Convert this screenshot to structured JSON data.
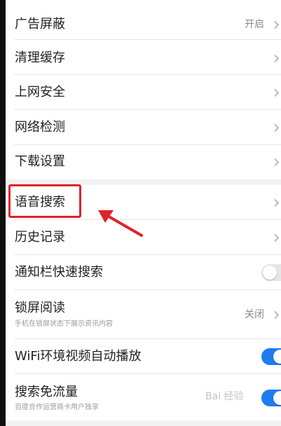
{
  "settings": {
    "ad_block": {
      "label": "广告屏蔽",
      "value": "开启"
    },
    "clear_cache": {
      "label": "清理缓存"
    },
    "web_security": {
      "label": "上网安全"
    },
    "network_check": {
      "label": "网络检测"
    },
    "download_settings": {
      "label": "下载设置"
    },
    "voice_search": {
      "label": "语音搜索"
    },
    "history": {
      "label": "历史记录"
    },
    "notification_quick_search": {
      "label": "通知栏快速搜索",
      "toggle_on": false
    },
    "lockscreen_reading": {
      "label": "锁屏阅读",
      "sublabel": "手机在锁屏状态下展示资讯内容",
      "value": "关闭"
    },
    "wifi_autoplay": {
      "label": "WiFi环境视频自动播放",
      "toggle_on": true
    },
    "search_free_data": {
      "label": "搜索免流量",
      "sublabel": "百度合作运营商卡用户独享",
      "toggle_on": true
    }
  },
  "watermark": {
    "text": "Bai 经验"
  },
  "colors": {
    "accent": "#1f7cf0",
    "annotation": "#e0222a"
  }
}
